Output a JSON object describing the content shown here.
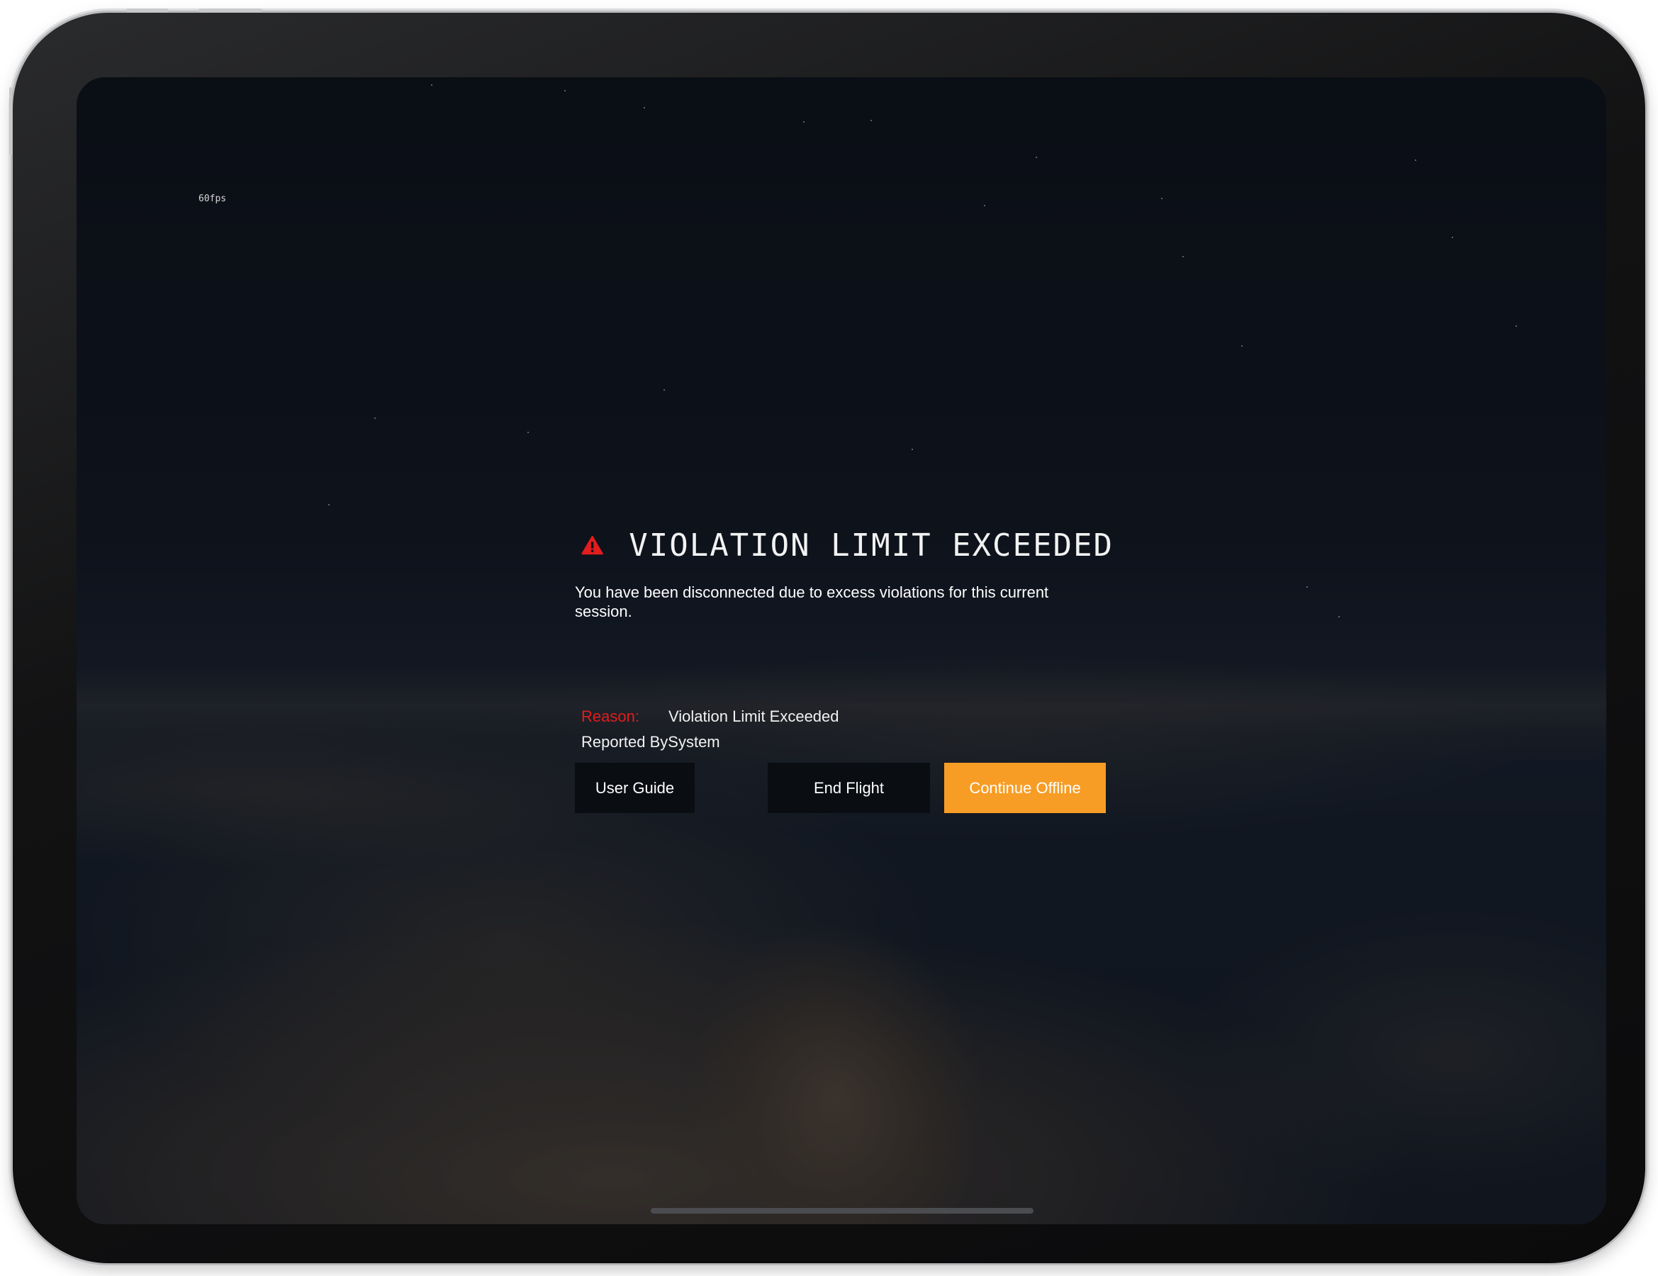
{
  "status_bar": {
    "fps_label": "60fps"
  },
  "alert": {
    "icon": "warning-triangle-icon",
    "title": "VIOLATION LIMIT EXCEEDED",
    "message": "You have been disconnected due to excess violations for this current session.",
    "reason_label": "Reason:",
    "reason_value": "Violation Limit Exceeded",
    "reported_by": "Reported BySystem"
  },
  "actions": {
    "user_guide_label": "User Guide",
    "end_flight_label": "End Flight",
    "continue_offline_label": "Continue Offline"
  },
  "colors": {
    "accent": "#f79d25",
    "warning": "#e11d1d",
    "button_dark": "#0a0d12"
  }
}
